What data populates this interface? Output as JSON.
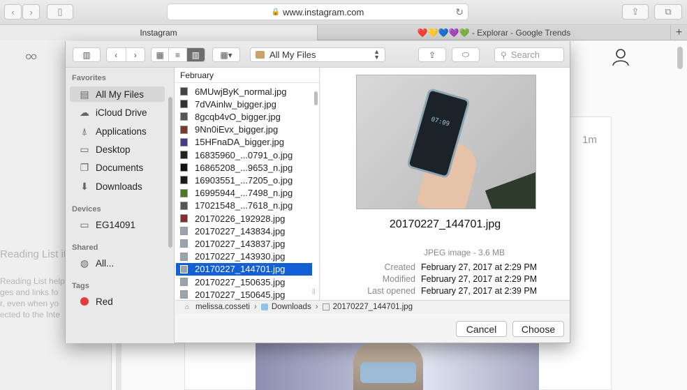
{
  "browser": {
    "address": "www.instagram.com",
    "tabs": [
      {
        "label": "Instagram"
      },
      {
        "label": "❤️💛💙💜💚 - Explorar - Google Trends"
      }
    ],
    "new_tab": "+"
  },
  "page": {
    "reading_list_title": "Reading List it",
    "reading_list_desc": [
      "Reading List helps yo",
      "ges and links fo",
      "r, even when yo",
      "ected to the Inte"
    ],
    "post_time": "1m"
  },
  "dialog": {
    "location": "All My Files",
    "search_placeholder": "Search",
    "sidebar": {
      "favorites_header": "Favorites",
      "favorites": [
        {
          "label": "All My Files",
          "icon": "all-files-icon",
          "selected": true
        },
        {
          "label": "iCloud Drive",
          "icon": "cloud-icon"
        },
        {
          "label": "Applications",
          "icon": "applications-icon"
        },
        {
          "label": "Desktop",
          "icon": "desktop-icon"
        },
        {
          "label": "Documents",
          "icon": "documents-icon"
        },
        {
          "label": "Downloads",
          "icon": "downloads-icon"
        }
      ],
      "devices_header": "Devices",
      "devices": [
        {
          "label": "EG14091",
          "icon": "laptop-icon"
        }
      ],
      "shared_header": "Shared",
      "shared": [
        {
          "label": "All...",
          "icon": "network-icon"
        }
      ],
      "tags_header": "Tags",
      "tags": [
        {
          "label": "Red",
          "color": "#e63b3b"
        }
      ]
    },
    "files_header": "February",
    "files": [
      {
        "name": "6MUwjByK_normal.jpg"
      },
      {
        "name": "7dVAinlw_bigger.jpg"
      },
      {
        "name": "8gcqb4vO_bigger.jpg"
      },
      {
        "name": "9Nn0iEvx_bigger.jpg"
      },
      {
        "name": "15HFnaDA_bigger.jpg"
      },
      {
        "name": "16835960_...0791_o.jpg"
      },
      {
        "name": "16865208_...9653_n.jpg"
      },
      {
        "name": "16903551_...7205_o.jpg"
      },
      {
        "name": "16995944_...7498_n.jpg"
      },
      {
        "name": "17021548_...7618_n.jpg"
      },
      {
        "name": "20170226_192928.jpg"
      },
      {
        "name": "20170227_143834.jpg"
      },
      {
        "name": "20170227_143837.jpg"
      },
      {
        "name": "20170227_143930.jpg"
      },
      {
        "name": "20170227_144701.jpg",
        "selected": true
      },
      {
        "name": "20170227_150635.jpg"
      },
      {
        "name": "20170227_150645.jpg"
      }
    ],
    "preview": {
      "filename": "20170227_144701.jpg",
      "kind": "JPEG image - 3.6 MB",
      "phone_time": "07:09",
      "created_label": "Created",
      "created": "February 27, 2017 at 2:29 PM",
      "modified_label": "Modified",
      "modified": "February 27, 2017 at 2:29 PM",
      "opened_label": "Last opened",
      "opened": "February 27, 2017 at 2:39 PM"
    },
    "path": [
      "melissa.cosseti",
      "Downloads",
      "20170227_144701.jpg"
    ],
    "path_sep": "›",
    "cancel_label": "Cancel",
    "choose_label": "Choose"
  }
}
